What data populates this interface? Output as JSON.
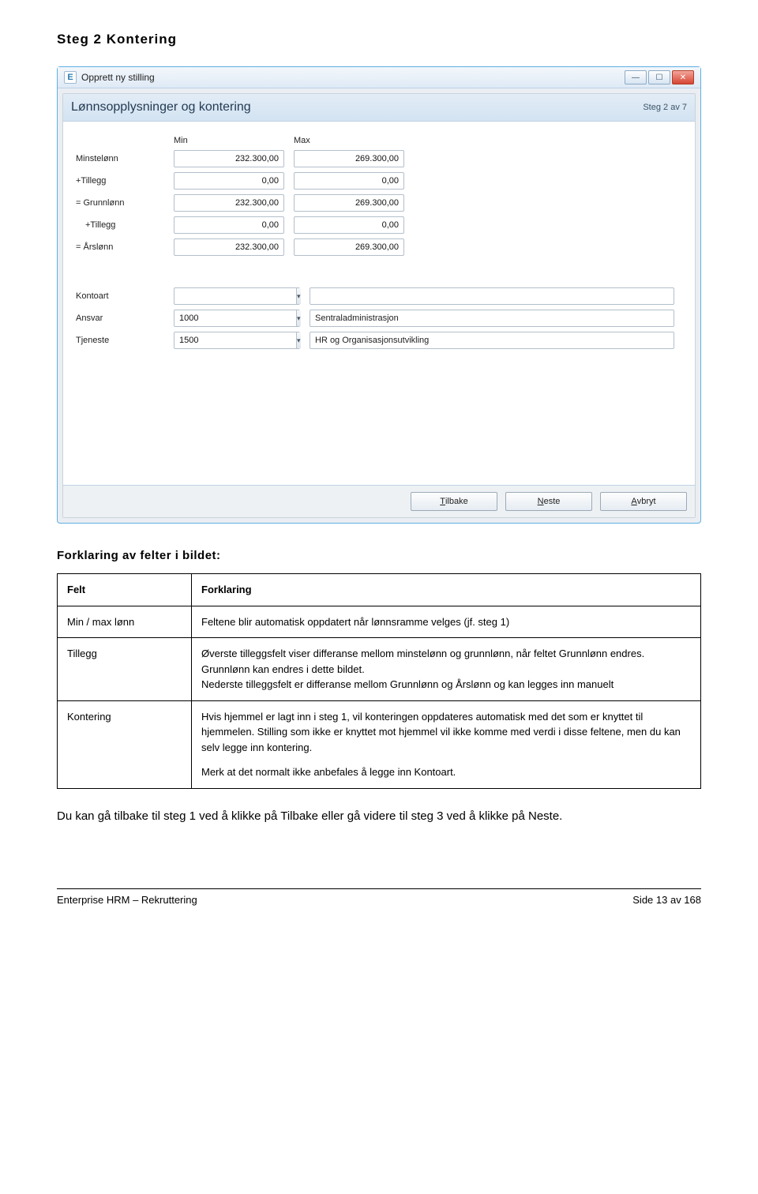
{
  "heading": "Steg 2 Kontering",
  "window": {
    "title": "Opprett ny stilling",
    "panel_title": "Lønnsopplysninger og kontering",
    "step_indicator": "Steg 2 av 7",
    "col_min": "Min",
    "col_max": "Max",
    "rows": [
      {
        "label": "Minstelønn",
        "min": "232.300,00",
        "max": "269.300,00"
      },
      {
        "label": "+Tillegg",
        "min": "0,00",
        "max": "0,00"
      },
      {
        "label": "= Grunnlønn",
        "min": "232.300,00",
        "max": "269.300,00"
      },
      {
        "label": "+Tillegg",
        "min": "0,00",
        "max": "0,00"
      },
      {
        "label": "= Årslønn",
        "min": "232.300,00",
        "max": "269.300,00"
      }
    ],
    "lookups": [
      {
        "label": "Kontoart",
        "code": "",
        "text": ""
      },
      {
        "label": "Ansvar",
        "code": "1000",
        "text": "Sentraladministrasjon"
      },
      {
        "label": "Tjeneste",
        "code": "1500",
        "text": "HR og Organisasjonsutvikling"
      }
    ],
    "btn_back": {
      "ul": "T",
      "rest": "ilbake"
    },
    "btn_next": {
      "ul": "N",
      "rest": "este"
    },
    "btn_cancel": {
      "ul": "A",
      "rest": "vbryt"
    }
  },
  "subheading": "Forklaring av felter i bildet:",
  "table": {
    "h_field": "Felt",
    "h_expl": "Forklaring",
    "r1_field": "Min / max lønn",
    "r1_expl": "Feltene blir automatisk oppdatert når lønnsramme velges (jf. steg 1)",
    "r2_field": "Tillegg",
    "r2_p1": "Øverste tilleggsfelt viser differanse mellom minstelønn og grunnlønn, når feltet Grunnlønn endres. Grunnlønn kan endres i dette bildet.",
    "r2_p2": "Nederste tilleggsfelt er differanse mellom Grunnlønn og Årslønn og kan legges inn manuelt",
    "r3_field": "Kontering",
    "r3_p1": "Hvis hjemmel er lagt inn i steg 1, vil konteringen oppdateres automatisk med det som er knyttet til hjemmelen. Stilling som ikke er knyttet mot hjemmel vil ikke komme med verdi i disse feltene, men du kan selv legge inn kontering.",
    "r3_p2": "Merk at det normalt ikke anbefales å legge inn Kontoart."
  },
  "closing": "Du kan gå tilbake til steg 1 ved å klikke på Tilbake eller gå videre til steg 3 ved å klikke på Neste.",
  "footer_left": "Enterprise HRM – Rekruttering",
  "footer_right": "Side 13 av 168"
}
